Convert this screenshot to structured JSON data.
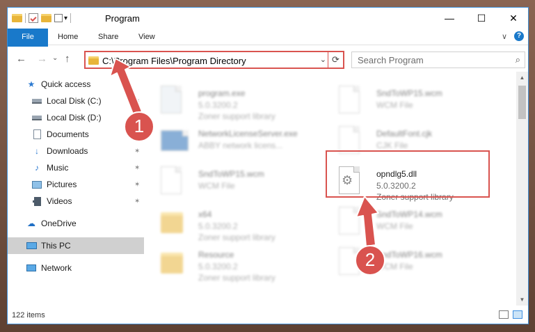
{
  "window": {
    "title": "Program",
    "quick_access_dropdown": "▾",
    "controls": {
      "minimize": "—",
      "maximize": "☐",
      "close": "✕"
    }
  },
  "ribbon": {
    "tabs": [
      {
        "label": "File"
      },
      {
        "label": "Home"
      },
      {
        "label": "Share"
      },
      {
        "label": "View"
      }
    ],
    "collapse": "∨",
    "help": "?"
  },
  "nav": {
    "back": "←",
    "forward": "→",
    "recent": "⌄",
    "up": "↑",
    "address": "C:\\Program Files\\Program Directory",
    "address_dropdown": "⌄",
    "refresh": "⟳",
    "search_placeholder": "Search Program",
    "search_icon": "⌕"
  },
  "sidebar": {
    "items": [
      {
        "label": "Quick access",
        "icon": "star-icon",
        "pinned": false
      },
      {
        "label": "Local Disk (C:)",
        "icon": "drive-icon",
        "pinned": true
      },
      {
        "label": "Local Disk (D:)",
        "icon": "drive-icon",
        "pinned": false
      },
      {
        "label": "Documents",
        "icon": "documents-icon",
        "pinned": true
      },
      {
        "label": "Downloads",
        "icon": "downloads-icon",
        "pinned": true
      },
      {
        "label": "Music",
        "icon": "music-icon",
        "pinned": true
      },
      {
        "label": "Pictures",
        "icon": "pictures-icon",
        "pinned": true
      },
      {
        "label": "Videos",
        "icon": "videos-icon",
        "pinned": true
      },
      {
        "label": "OneDrive",
        "icon": "cloud-icon",
        "pinned": false
      },
      {
        "label": "This PC",
        "icon": "computer-icon",
        "pinned": false,
        "selected": true
      },
      {
        "label": "Network",
        "icon": "network-icon",
        "pinned": false
      }
    ],
    "pin_glyph": "⌕"
  },
  "files": [
    {
      "name": "program.exe",
      "line1": "5.0.3200.2",
      "line2": "Zoner support library",
      "kind": "exe",
      "blurred": true
    },
    {
      "name": "SndToWP15.wcm",
      "line1": "WCM File",
      "line2": "",
      "kind": "doc",
      "blurred": true
    },
    {
      "name": "NetworkLicenseServer.exe",
      "line1": "ABBY network licens...",
      "line2": "",
      "kind": "exe2",
      "blurred": true
    },
    {
      "name": "DefaultFont.cjk",
      "line1": "CJK File",
      "line2": "",
      "kind": "doc",
      "blurred": true
    },
    {
      "name": "SndToWP15.wcm",
      "line1": "WCM File",
      "line2": "",
      "kind": "doc",
      "blurred": true
    },
    {
      "name": "opndlg5.dll",
      "line1": "5.0.3200.2",
      "line2": "Zoner support library",
      "kind": "dll",
      "blurred": false
    },
    {
      "name": "x64",
      "line1": "5.0.3200.2",
      "line2": "Zoner support library",
      "kind": "folder",
      "blurred": true
    },
    {
      "name": "SndToWP14.wcm",
      "line1": "WCM File",
      "line2": "",
      "kind": "doc",
      "blurred": true
    },
    {
      "name": "Resource",
      "line1": "5.0.3200.2",
      "line2": "Zoner support library",
      "kind": "folder",
      "blurred": true
    },
    {
      "name": "SndToWP16.wcm",
      "line1": "WCM File",
      "line2": "",
      "kind": "doc",
      "blurred": true
    }
  ],
  "status": {
    "count": "122 items"
  },
  "scroll": {
    "up": "▲",
    "down": "▼"
  },
  "annotations": {
    "step1": "1",
    "step2": "2"
  },
  "colors": {
    "accent": "#1979ca",
    "annotation": "#d9534f",
    "folder": "#e8b53a"
  }
}
